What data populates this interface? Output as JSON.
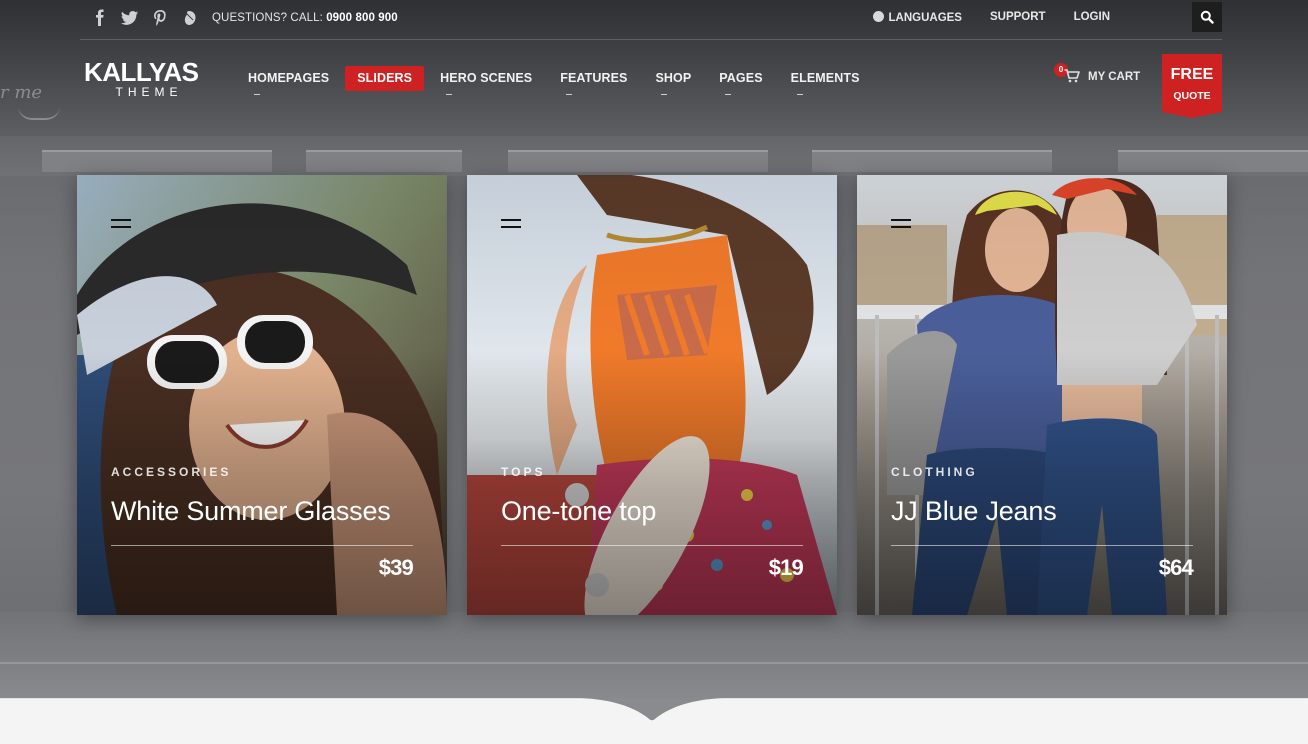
{
  "topbar": {
    "social_icons": [
      "facebook-icon",
      "twitter-icon",
      "pinterest-icon",
      "dribbble-icon"
    ],
    "questions_label": "QUESTIONS? CALL: ",
    "phone": "0900 800 900",
    "languages": "LANGUAGES",
    "support": "SUPPORT",
    "login": "LOGIN"
  },
  "hero": {
    "script_text": "r me"
  },
  "logo": {
    "main": "KALLYAS",
    "sub": "THEME"
  },
  "nav": {
    "items": [
      {
        "label": "HOMEPAGES",
        "active": false
      },
      {
        "label": "SLIDERS",
        "active": true
      },
      {
        "label": "HERO SCENES",
        "active": false
      },
      {
        "label": "FEATURES",
        "active": false
      },
      {
        "label": "SHOP",
        "active": false
      },
      {
        "label": "PAGES",
        "active": false
      },
      {
        "label": "ELEMENTS",
        "active": false
      }
    ]
  },
  "cart": {
    "count": "0",
    "label": "MY CART"
  },
  "quote": {
    "line1": "FREE",
    "line2": "QUOTE"
  },
  "products": [
    {
      "category": "ACCESSORIES",
      "name": "White Summer Glasses",
      "price": "$39"
    },
    {
      "category": "TOPS",
      "name": "One-tone top",
      "price": "$19"
    },
    {
      "category": "CLOTHING",
      "name": "JJ Blue Jeans",
      "price": "$64"
    }
  ],
  "colors": {
    "accent": "#cd2122",
    "topbar_bg": "#303134",
    "panel": "#f4f4f4"
  }
}
